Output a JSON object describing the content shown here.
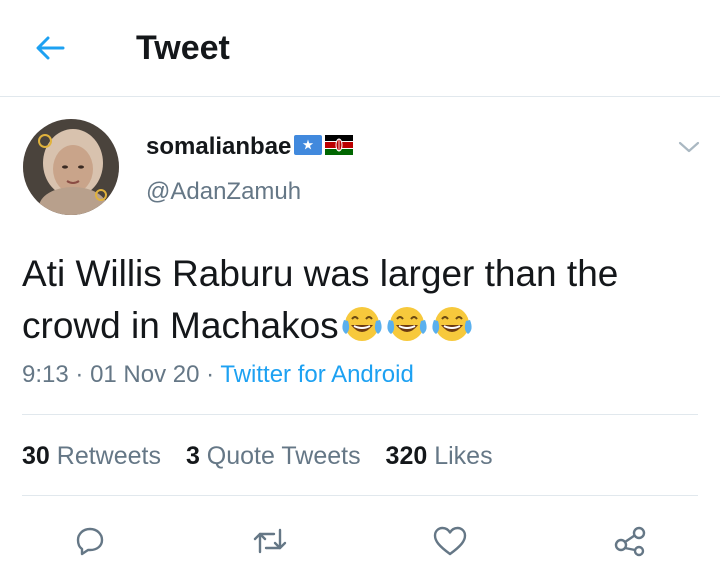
{
  "header": {
    "title": "Tweet",
    "back_icon": "arrow-left-icon",
    "accent": "#1da1f2"
  },
  "author": {
    "display_name": "somalianbae",
    "flags": [
      "somalia-flag-icon",
      "kenya-flag-icon"
    ],
    "handle": "@AdanZamuh"
  },
  "tweet": {
    "text": "Ati Willis Raburu was larger than the crowd in Machakos",
    "emojis": [
      "tears-of-joy-emoji",
      "tears-of-joy-emoji",
      "tears-of-joy-emoji"
    ]
  },
  "meta": {
    "time": "9:13",
    "date": "01 Nov 20",
    "separator": "·",
    "source": "Twitter for Android"
  },
  "stats": {
    "retweets_count": "30",
    "retweets_label": "Retweets",
    "quotes_count": "3",
    "quotes_label": "Quote Tweets",
    "likes_count": "320",
    "likes_label": "Likes"
  },
  "actions": [
    "reply-icon",
    "retweet-icon",
    "like-icon",
    "share-icon"
  ],
  "colors": {
    "text": "#14171a",
    "secondary": "#657786",
    "divider": "#e1e8ed"
  }
}
